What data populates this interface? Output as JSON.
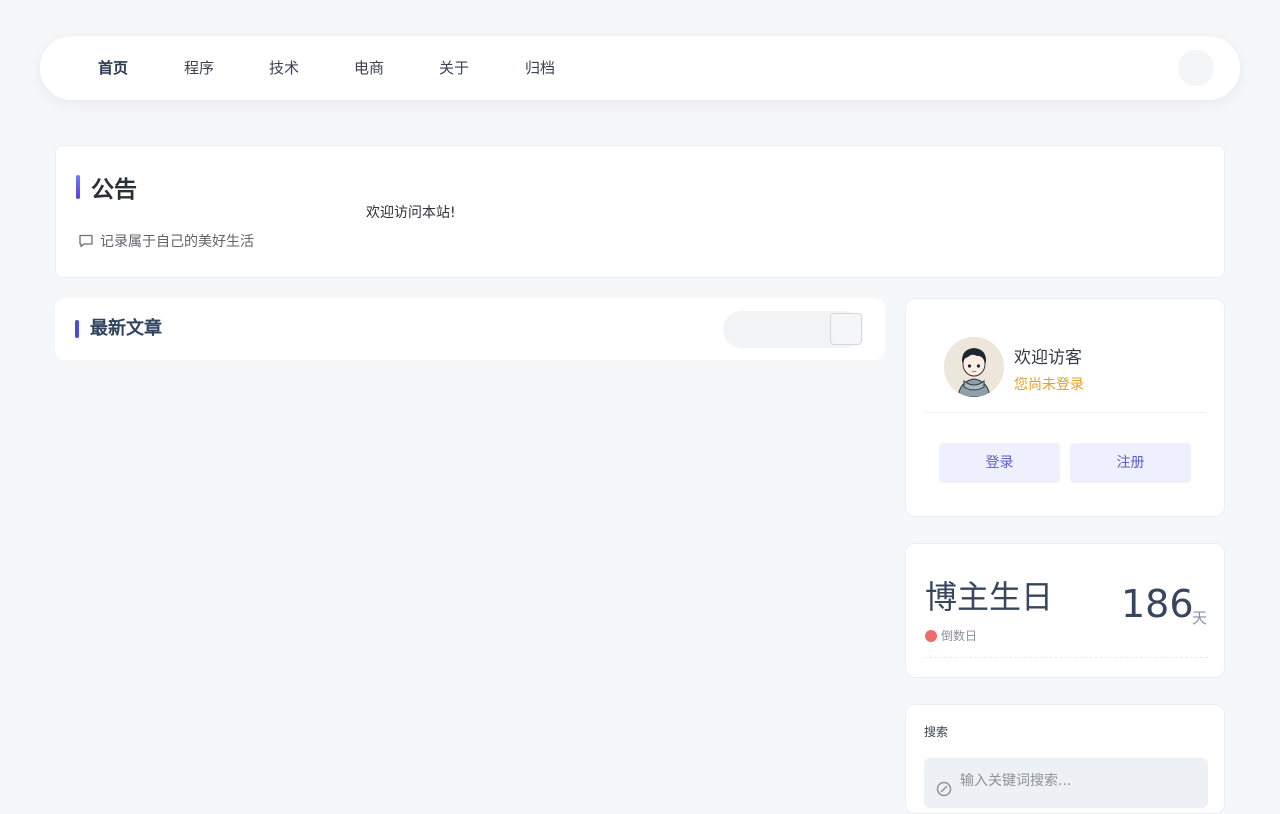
{
  "nav": {
    "items": [
      {
        "label": "首页"
      },
      {
        "label": "程序"
      },
      {
        "label": "技术"
      },
      {
        "label": "电商"
      },
      {
        "label": "关于"
      },
      {
        "label": "归档"
      }
    ]
  },
  "notice": {
    "title": "公告",
    "subtitle": "记录属于自己的美好生活",
    "message": "欢迎访问本站!"
  },
  "latest": {
    "title": "最新文章"
  },
  "user": {
    "welcome": "欢迎访客",
    "status": "您尚未登录",
    "login_label": "登录",
    "register_label": "注册"
  },
  "birthday": {
    "title": "博主生日",
    "label": "倒数日",
    "days": "186",
    "unit": "天"
  },
  "search": {
    "title": "搜索",
    "placeholder": "输入关键词搜索..."
  },
  "colors": {
    "accent": "#5b5fc7",
    "warning": "#e6a023",
    "dot": "#ee6b6e"
  }
}
